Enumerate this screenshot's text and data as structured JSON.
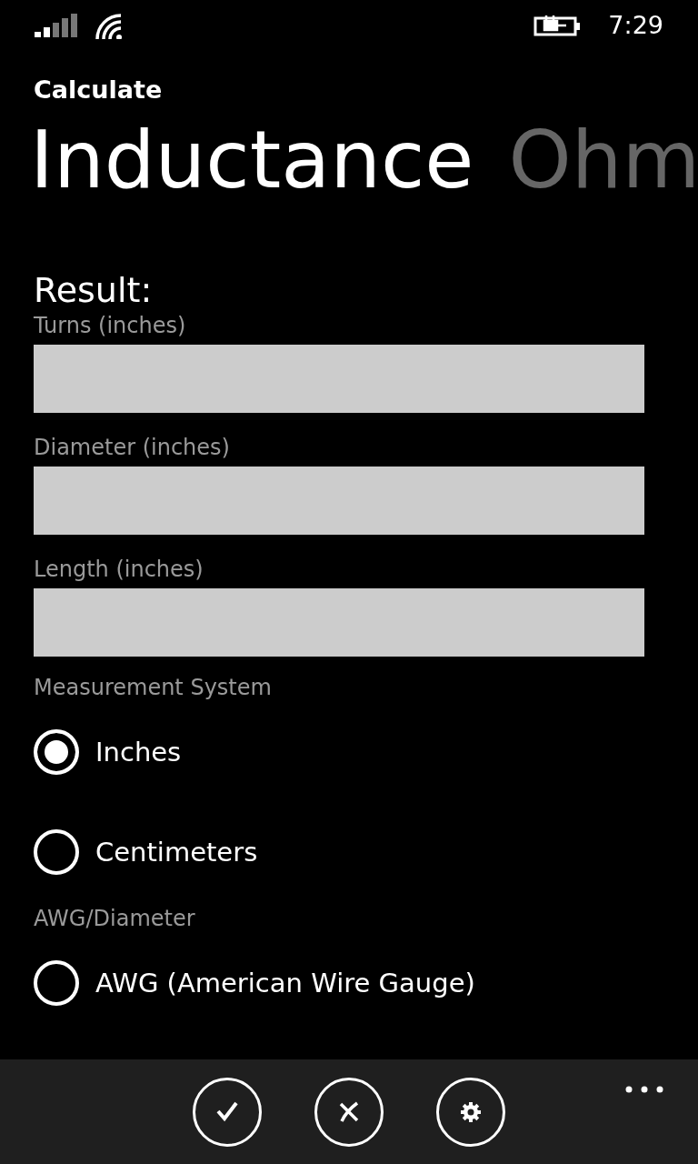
{
  "status_bar": {
    "time": "7:29"
  },
  "app_title": "Calculate",
  "pivot": [
    {
      "label": "Inductance",
      "selected": true
    },
    {
      "label": "Ohm",
      "selected": false
    }
  ],
  "result_label": "Result:",
  "fields": [
    {
      "label": "Turns (inches)"
    },
    {
      "label": "Diameter (inches)"
    },
    {
      "label": "Length (inches)"
    }
  ],
  "radio_groups": [
    {
      "label": "Measurement System",
      "options": [
        {
          "label": "Inches",
          "selected": true
        },
        {
          "label": "Centimeters",
          "selected": false
        }
      ]
    },
    {
      "label": "AWG/Diameter",
      "options": [
        {
          "label": "AWG (American Wire Gauge)",
          "selected": false
        }
      ]
    }
  ],
  "app_bar": {
    "buttons": [
      {
        "kind": "check"
      },
      {
        "kind": "cancel"
      },
      {
        "kind": "settings"
      }
    ]
  }
}
